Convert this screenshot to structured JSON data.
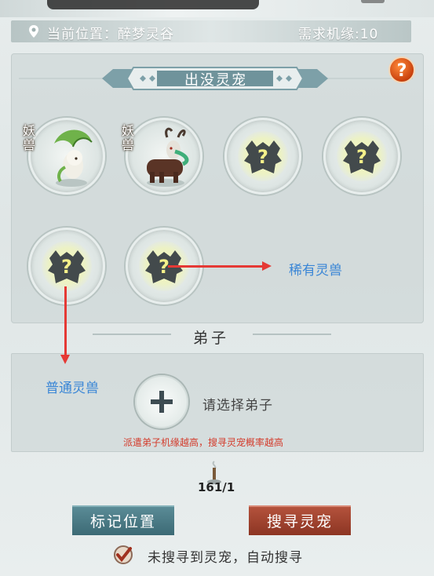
{
  "location_bar": {
    "label": "当前位置：醉梦灵谷",
    "requirement": "需求机缘:10"
  },
  "pets_section": {
    "title": "出没灵宠",
    "help_icon": "question-mark",
    "slots": [
      {
        "tag": "妖兽",
        "state": "revealed",
        "creature": "green-leaf-sprite"
      },
      {
        "tag": "妖兽",
        "state": "revealed",
        "creature": "antlered-deer-beast"
      },
      {
        "state": "unknown",
        "icon": "question-mark-beast-silhouette"
      },
      {
        "state": "unknown",
        "icon": "question-mark-beast-silhouette"
      },
      {
        "state": "unknown",
        "icon": "question-mark-beast-silhouette"
      },
      {
        "state": "unknown",
        "icon": "question-mark-beast-silhouette"
      }
    ]
  },
  "annotations": {
    "rare": "稀有灵兽",
    "common": "普通灵兽",
    "arrow_color": "#e53935",
    "text_color": "#3a86d6"
  },
  "disciple": {
    "title": "弟子",
    "choose": "请选择弟子",
    "hint": "派遣弟子机缘越高，搜寻灵宠概率越高"
  },
  "incense": {
    "count": "161/1"
  },
  "buttons": {
    "mark": "标记位置",
    "search": "搜寻灵宠",
    "mark_color": "#4a7a85",
    "search_color": "#a2452f"
  },
  "auto_search": {
    "label": "未搜寻到灵宠，自动搜寻",
    "checked": true
  }
}
